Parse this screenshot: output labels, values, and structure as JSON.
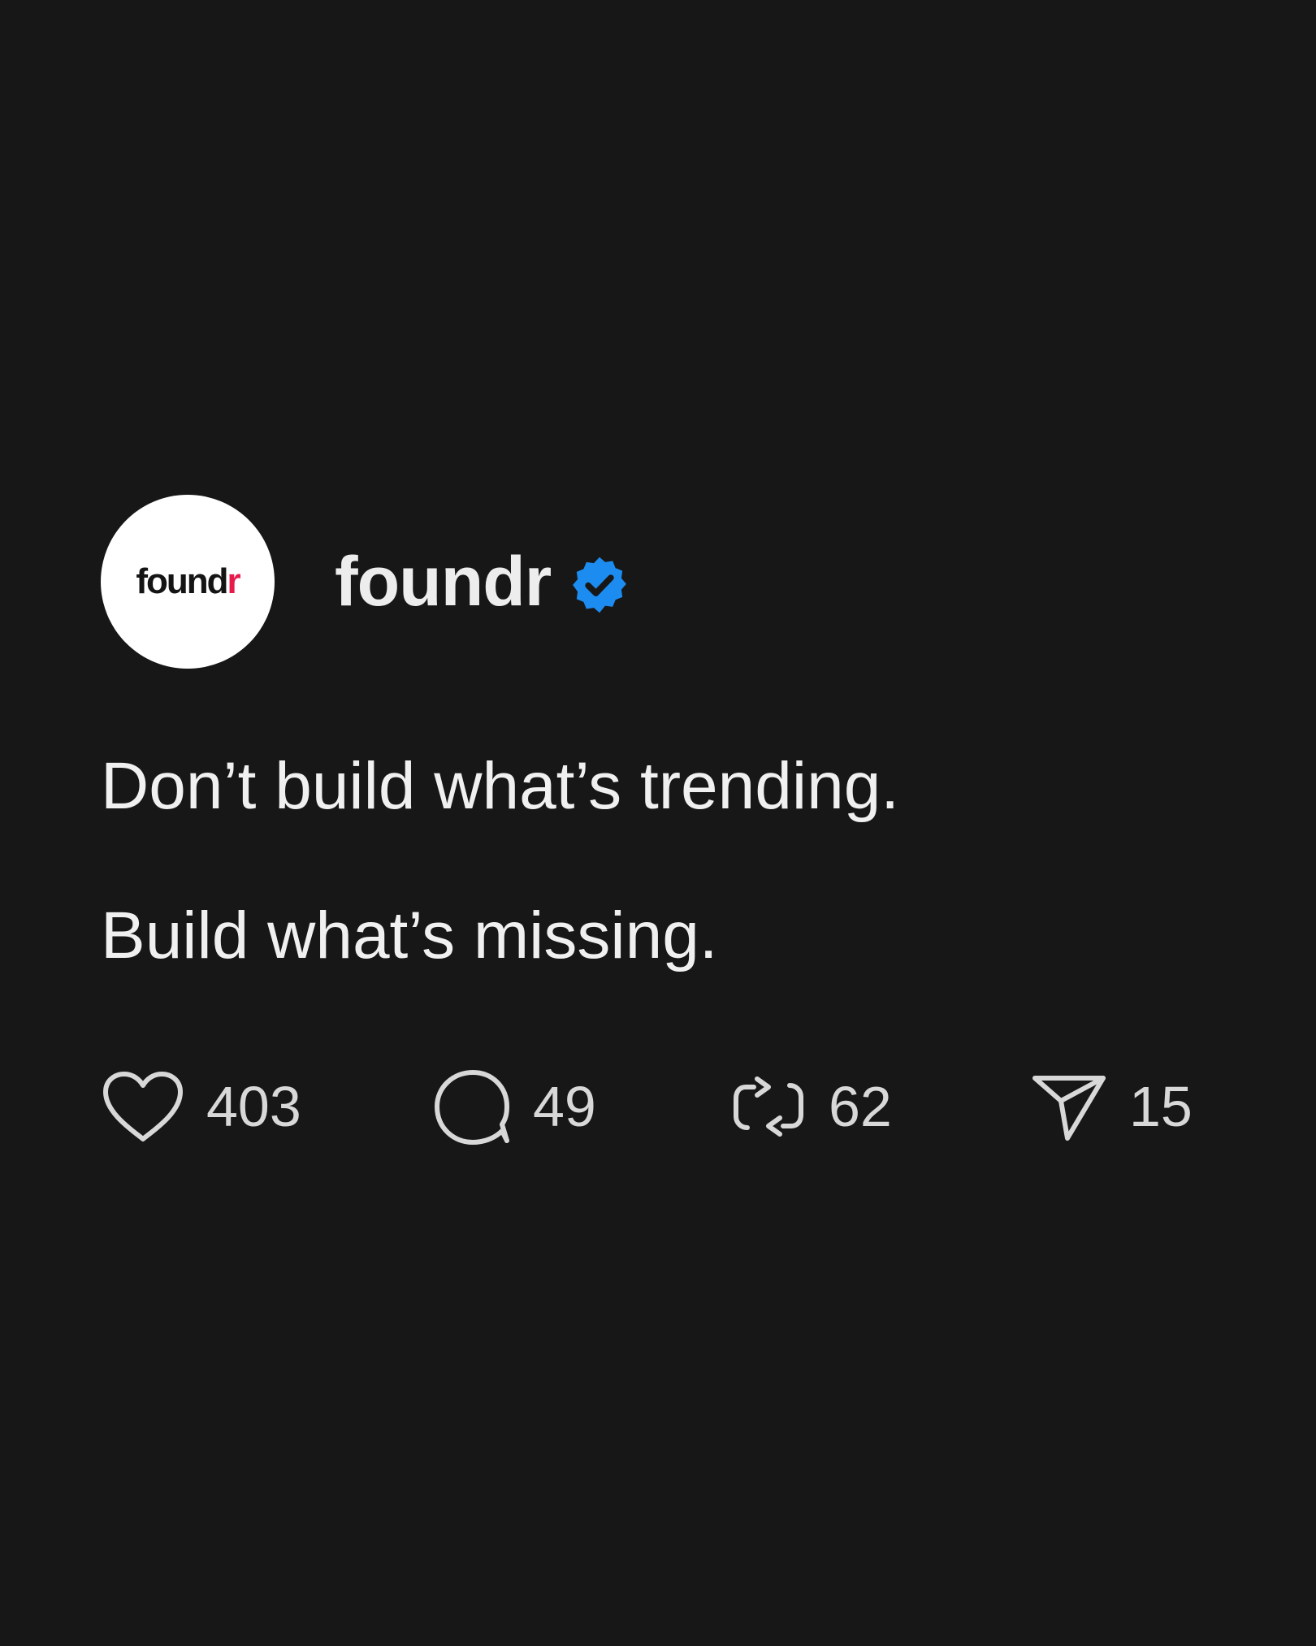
{
  "profile": {
    "avatar_logo_main": "found",
    "avatar_logo_accent": "r",
    "username": "foundr",
    "verified_icon": "verified-badge-icon",
    "accent_color": "#1d8cf0",
    "logo_accent_color": "#e8194b"
  },
  "post": {
    "lines": [
      "Don’t build what’s trending.",
      "Build what’s missing."
    ]
  },
  "actions": {
    "likes": "403",
    "comments": "49",
    "reposts": "62",
    "shares": "15",
    "icons": [
      "heart-icon",
      "comment-icon",
      "repost-icon",
      "share-icon"
    ]
  }
}
